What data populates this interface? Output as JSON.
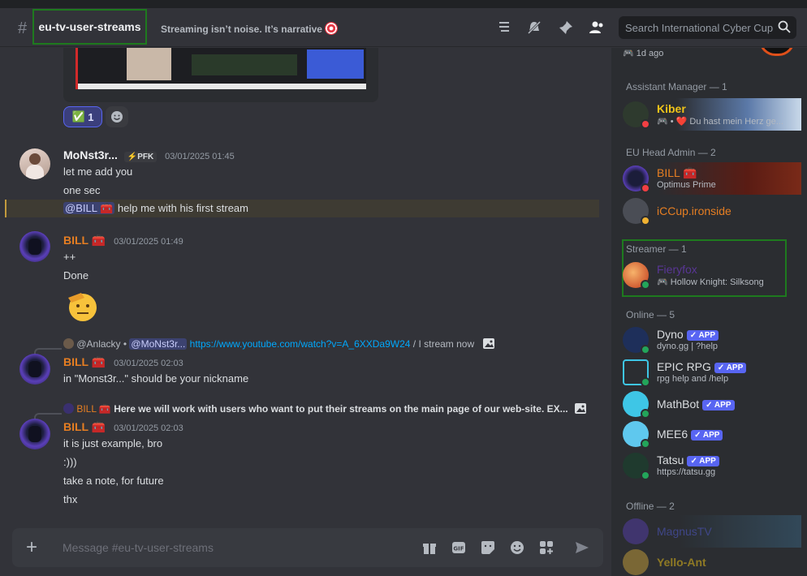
{
  "header": {
    "channel_name": "eu-tv-user-streams",
    "topic": "Streaming isn’t noise. It’s narrative",
    "search_placeholder": "Search International Cyber Cup"
  },
  "reactions": [
    {
      "emoji": "✅",
      "count": "1"
    }
  ],
  "messages": [
    {
      "author": "MoNst3r...",
      "badge": "⚡PFK",
      "timestamp": "03/01/2025 01:45",
      "lines": [
        "let me add you",
        "one sec"
      ],
      "mention_line": {
        "mention": "@BILL 🧰",
        "text": " help me with his first stream"
      }
    },
    {
      "author": "BILL 🧰",
      "timestamp": "03/01/2025 01:49",
      "lines": [
        "++",
        "Done"
      ]
    },
    {
      "reply": {
        "author": "@Anlacky",
        "mention": "@MoNst3r...",
        "link": "https://www.youtube.com/watch?v=A_6XXDa9W24",
        "text": " / I stream now"
      },
      "author": "BILL 🧰",
      "timestamp": "03/01/2025 02:03",
      "lines": [
        "in \"Monst3r...\" should be your nickname"
      ]
    },
    {
      "reply": {
        "author": "BILL 🧰",
        "text": "Here we will work with users who want to put their streams on the main page of our web-site.  EX..."
      },
      "author": "BILL 🧰",
      "timestamp": "03/01/2025 02:03",
      "lines": [
        "it is just example, bro",
        ":)))",
        "take a note, for future",
        "thx"
      ]
    }
  ],
  "composer": {
    "placeholder": "Message #eu-tv-user-streams"
  },
  "members": {
    "top_item": {
      "sub": "1d ago"
    },
    "groups": [
      {
        "label": "Assistant Manager — 1",
        "items": [
          {
            "name": "Kiber",
            "sub": "🎮 • ❤️ Du hast mein Herz ge..."
          }
        ]
      },
      {
        "label": "EU Head Admin — 2",
        "items": [
          {
            "name": "BILL 🧰",
            "sub": "Optimus Prime"
          },
          {
            "name": "iCCup.ironside",
            "sub": ""
          }
        ]
      },
      {
        "label": "Streamer — 1",
        "items": [
          {
            "name": "Fieryfox",
            "sub": "Hollow Knight: Silksong"
          }
        ]
      },
      {
        "label": "Online — 5",
        "items": [
          {
            "name": "Dyno",
            "badge": "✓ APP",
            "sub": "dyno.gg | ?help"
          },
          {
            "name": "EPIC RPG",
            "badge": "✓ APP",
            "sub": "rpg help and /help"
          },
          {
            "name": "MathBot",
            "badge": "✓ APP",
            "sub": ""
          },
          {
            "name": "MEE6",
            "badge": "✓ APP",
            "sub": ""
          },
          {
            "name": "Tatsu",
            "badge": "✓ APP",
            "sub": "https://tatsu.gg"
          }
        ]
      },
      {
        "label": "Offline — 2",
        "items": [
          {
            "name": "MagnusTV",
            "sub": ""
          },
          {
            "name": "Yello-Ant",
            "sub": ""
          }
        ]
      }
    ]
  },
  "colors": {
    "accent": "#5865f2",
    "orange": "#e67e22",
    "online": "#23a55a",
    "dnd": "#f23f43",
    "highlight_box": "#1e7a1e"
  }
}
